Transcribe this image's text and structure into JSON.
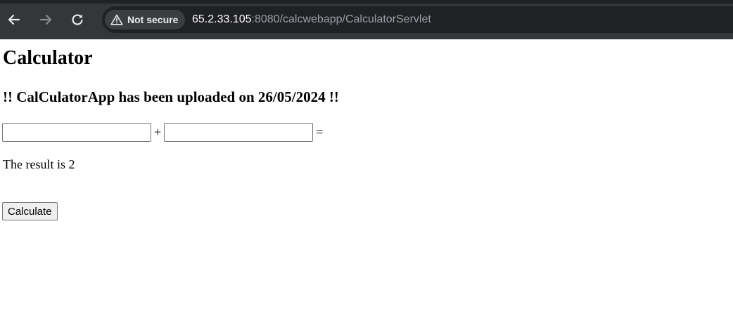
{
  "browser": {
    "security_label": "Not secure",
    "url_host": "65.2.33.105",
    "url_rest": ":8080/calcwebapp/CalculatorServlet",
    "icons": {
      "back": "arrow-left-icon",
      "forward": "arrow-right-icon",
      "reload": "reload-icon",
      "security": "warning-triangle-icon"
    },
    "colors": {
      "toolbar_bg": "#35363a",
      "omnibox_bg": "#202124",
      "icon": "#e8eaed",
      "icon_disabled": "#8a8c90"
    }
  },
  "page": {
    "title": "Calculator",
    "subtitle": "!! CalCulatorApp has been uploaded on 26/05/2024 !!",
    "form": {
      "num1_value": "",
      "num2_value": "",
      "plus": "+",
      "equals": "="
    },
    "result_text": "The result is 2",
    "calculate_label": "Calculate"
  }
}
